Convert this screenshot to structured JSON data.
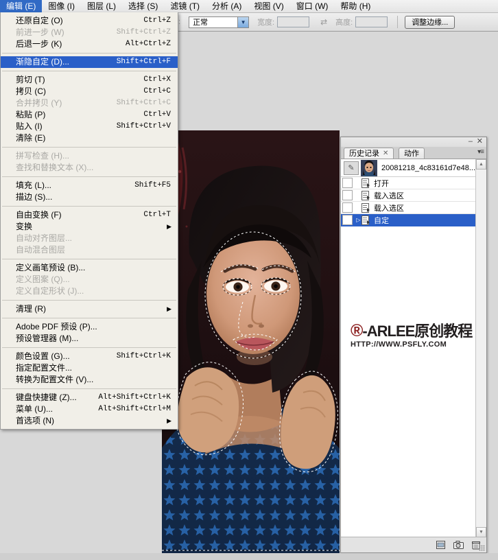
{
  "app": {
    "menubar": [
      {
        "label": "编辑 (E)",
        "active": true
      },
      {
        "label": "图像 (I)",
        "active": false
      },
      {
        "label": "图层 (L)",
        "active": false
      },
      {
        "label": "选择 (S)",
        "active": false
      },
      {
        "label": "滤镜 (T)",
        "active": false
      },
      {
        "label": "分析 (A)",
        "active": false
      },
      {
        "label": "视图 (V)",
        "active": false
      },
      {
        "label": "窗口 (W)",
        "active": false
      },
      {
        "label": "帮助 (H)",
        "active": false
      }
    ]
  },
  "options_bar": {
    "style_value": "正常",
    "width_label": "宽度:",
    "width_value": "",
    "swap_icon": "swap-arrows-icon",
    "height_label": "高度:",
    "height_value": "",
    "refine_edge_label": "调整边缘..."
  },
  "edit_menu": {
    "items": [
      {
        "label": "还原自定 (O)",
        "accel": "Ctrl+Z",
        "state": "normal"
      },
      {
        "label": "前进一步 (W)",
        "accel": "Shift+Ctrl+Z",
        "state": "disabled"
      },
      {
        "label": "后退一步 (K)",
        "accel": "Alt+Ctrl+Z",
        "state": "normal"
      },
      {
        "type": "separator"
      },
      {
        "label": "渐隐自定 (D)...",
        "accel": "Shift+Ctrl+F",
        "state": "selected"
      },
      {
        "type": "separator"
      },
      {
        "label": "剪切 (T)",
        "accel": "Ctrl+X",
        "state": "normal"
      },
      {
        "label": "拷贝 (C)",
        "accel": "Ctrl+C",
        "state": "normal"
      },
      {
        "label": "合并拷贝 (Y)",
        "accel": "Shift+Ctrl+C",
        "state": "disabled"
      },
      {
        "label": "粘贴 (P)",
        "accel": "Ctrl+V",
        "state": "normal"
      },
      {
        "label": "贴入 (I)",
        "accel": "Shift+Ctrl+V",
        "state": "normal"
      },
      {
        "label": "清除 (E)",
        "accel": "",
        "state": "normal"
      },
      {
        "type": "separator"
      },
      {
        "label": "拼写检查 (H)...",
        "accel": "",
        "state": "disabled"
      },
      {
        "label": "查找和替换文本 (X)...",
        "accel": "",
        "state": "disabled"
      },
      {
        "type": "separator"
      },
      {
        "label": "填充 (L)...",
        "accel": "Shift+F5",
        "state": "normal"
      },
      {
        "label": "描边 (S)...",
        "accel": "",
        "state": "normal"
      },
      {
        "type": "separator"
      },
      {
        "label": "自由变换 (F)",
        "accel": "Ctrl+T",
        "state": "normal"
      },
      {
        "label": "变换",
        "accel": "",
        "state": "submenu"
      },
      {
        "label": "自动对齐图层...",
        "accel": "",
        "state": "disabled"
      },
      {
        "label": "自动混合图层",
        "accel": "",
        "state": "disabled"
      },
      {
        "type": "separator"
      },
      {
        "label": "定义画笔预设 (B)...",
        "accel": "",
        "state": "normal"
      },
      {
        "label": "定义图案 (Q)...",
        "accel": "",
        "state": "disabled"
      },
      {
        "label": "定义自定形状 (J)...",
        "accel": "",
        "state": "disabled"
      },
      {
        "type": "separator"
      },
      {
        "label": "清理 (R)",
        "accel": "",
        "state": "submenu"
      },
      {
        "type": "separator"
      },
      {
        "label": "Adobe PDF 预设 (P)...",
        "accel": "",
        "state": "normal"
      },
      {
        "label": "预设管理器 (M)...",
        "accel": "",
        "state": "normal"
      },
      {
        "type": "separator"
      },
      {
        "label": "颜色设置 (G)...",
        "accel": "Shift+Ctrl+K",
        "state": "normal"
      },
      {
        "label": "指定配置文件...",
        "accel": "",
        "state": "normal"
      },
      {
        "label": "转换为配置文件 (V)...",
        "accel": "",
        "state": "normal"
      },
      {
        "type": "separator"
      },
      {
        "label": "键盘快捷键 (Z)...",
        "accel": "Alt+Shift+Ctrl+K",
        "state": "normal"
      },
      {
        "label": "菜单 (U)...",
        "accel": "Alt+Shift+Ctrl+M",
        "state": "normal"
      },
      {
        "label": "首选项 (N)",
        "accel": "",
        "state": "submenu"
      }
    ]
  },
  "history_panel": {
    "minimize_icon": "minimize-icon",
    "close_icon": "close-icon",
    "panel_menu_icon": "panel-menu-icon",
    "tabs": [
      {
        "label": "历史记录",
        "active": true,
        "closable": true
      },
      {
        "label": "动作",
        "active": false,
        "closable": false
      }
    ],
    "snapshot": {
      "icon": "snapshot-brush-icon",
      "name": "20081218_4c83161d7e48..."
    },
    "states": [
      {
        "label": "打开",
        "selected": false,
        "current": false
      },
      {
        "label": "载入选区",
        "selected": false,
        "current": false
      },
      {
        "label": "载入选区",
        "selected": false,
        "current": false
      },
      {
        "label": "自定",
        "selected": true,
        "current": true
      }
    ],
    "footer_icons": [
      {
        "name": "new-document-icon",
        "glyph": "▤"
      },
      {
        "name": "new-snapshot-camera-icon",
        "glyph": "▣"
      },
      {
        "name": "delete-trash-icon",
        "glyph": "🗑"
      }
    ],
    "scroll": {
      "up_icon": "scroll-up-icon",
      "down_icon": "scroll-down-icon"
    }
  },
  "watermark": {
    "registered_mark": "®",
    "brand": "-ARLEE原创教程",
    "url": "HTTP://WWW.PSFLY.COM",
    "accent_color": "#8c2121"
  }
}
